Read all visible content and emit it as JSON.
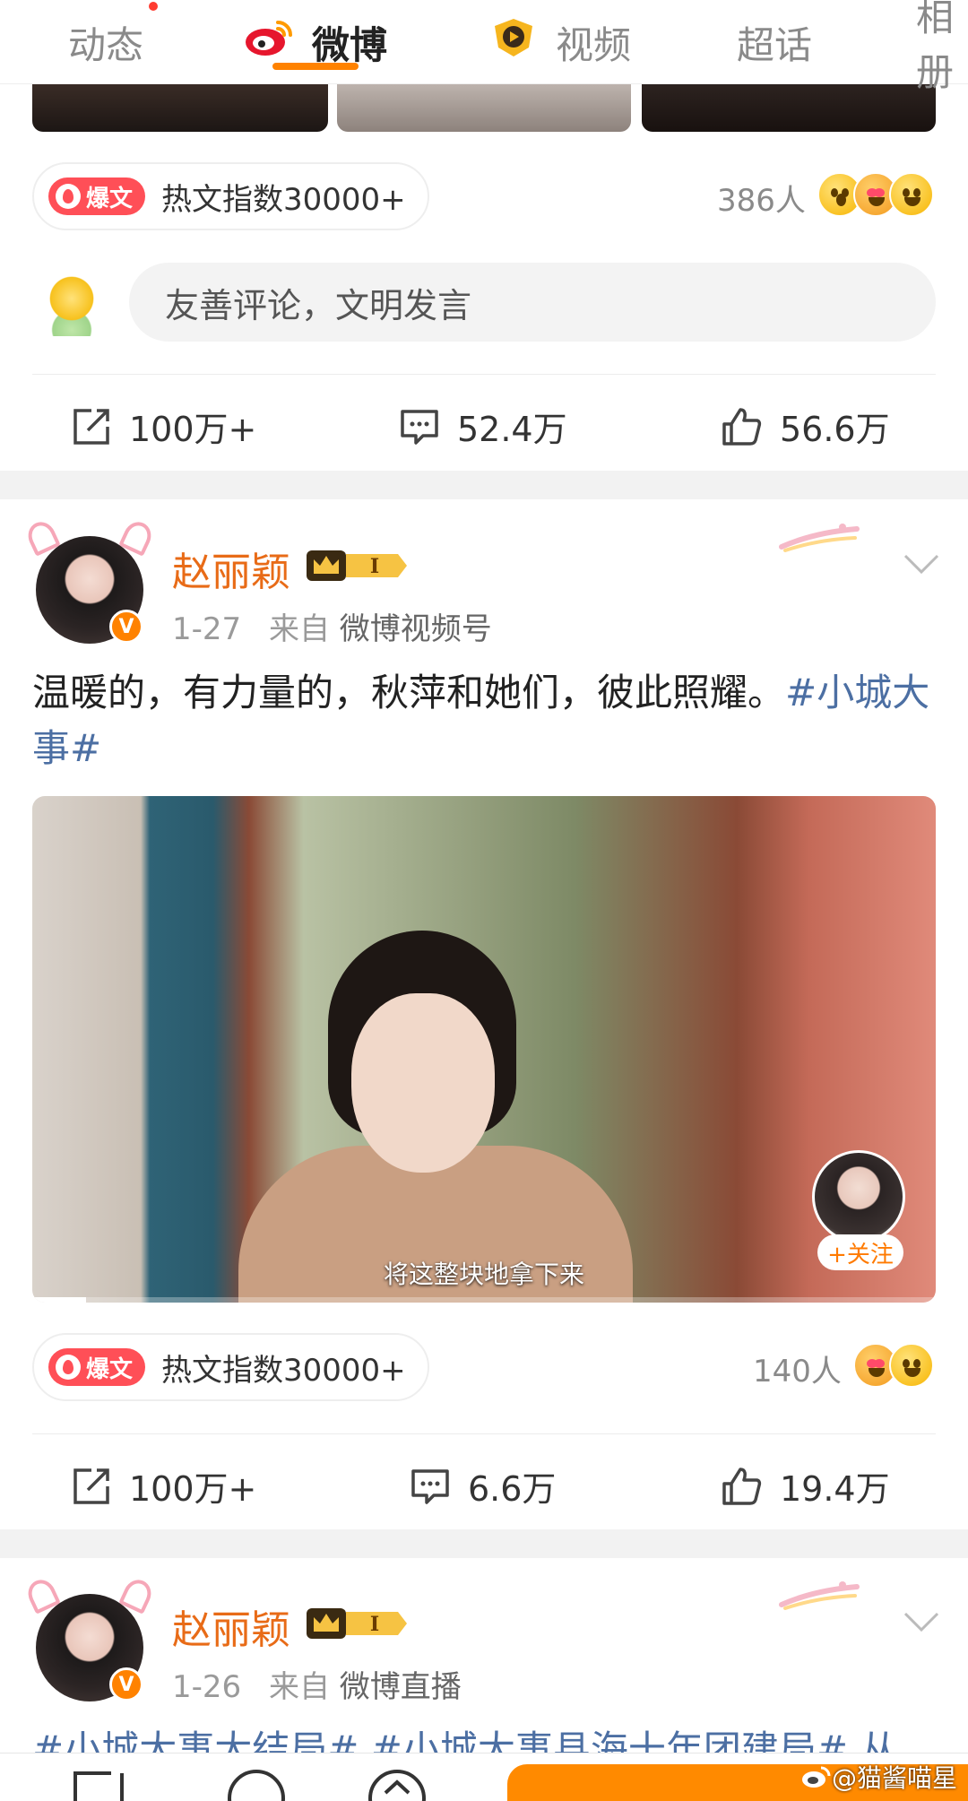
{
  "tabs": [
    {
      "label": "动态",
      "has_dot": true
    },
    {
      "label": "微博",
      "active": true,
      "icon": "weibo-logo-icon"
    },
    {
      "label": "视频",
      "icon": "video-logo-icon"
    },
    {
      "label": "超话"
    },
    {
      "label": "相册"
    }
  ],
  "post1": {
    "hot_badge": "爆文",
    "hot_index": "热文指数30000+",
    "reaction_count": "386人",
    "comment_placeholder": "友善评论，文明发言",
    "repost": "100万+",
    "comments": "52.4万",
    "likes": "56.6万"
  },
  "post2": {
    "author": "赵丽颖",
    "level": "I",
    "date": "1-27",
    "from_prefix": "来自",
    "source": "微博视频号",
    "text": "温暖的，有力量的，秋萍和她们，彼此照耀。",
    "hashtag": "#小城大事#",
    "video_subtitle": "将这整块地拿下来",
    "follow_label": "+关注",
    "video_progress": 0.06,
    "hot_badge": "爆文",
    "hot_index": "热文指数30000+",
    "reaction_count": "140人",
    "repost": "100万+",
    "comments": "6.6万",
    "likes": "19.4万"
  },
  "post3": {
    "author": "赵丽颖",
    "level": "I",
    "date": "1-26",
    "from_prefix": "来自",
    "source": "微博直播",
    "text_partial": "#小城大事大结局# #小城大事县海十年团建局# 从"
  },
  "watermark": "@猫酱喵星",
  "colors": {
    "accent": "#ff8200",
    "author": "#e86b17",
    "hashtag": "#4c6fa3",
    "hot_badge": "#ff4f57"
  }
}
